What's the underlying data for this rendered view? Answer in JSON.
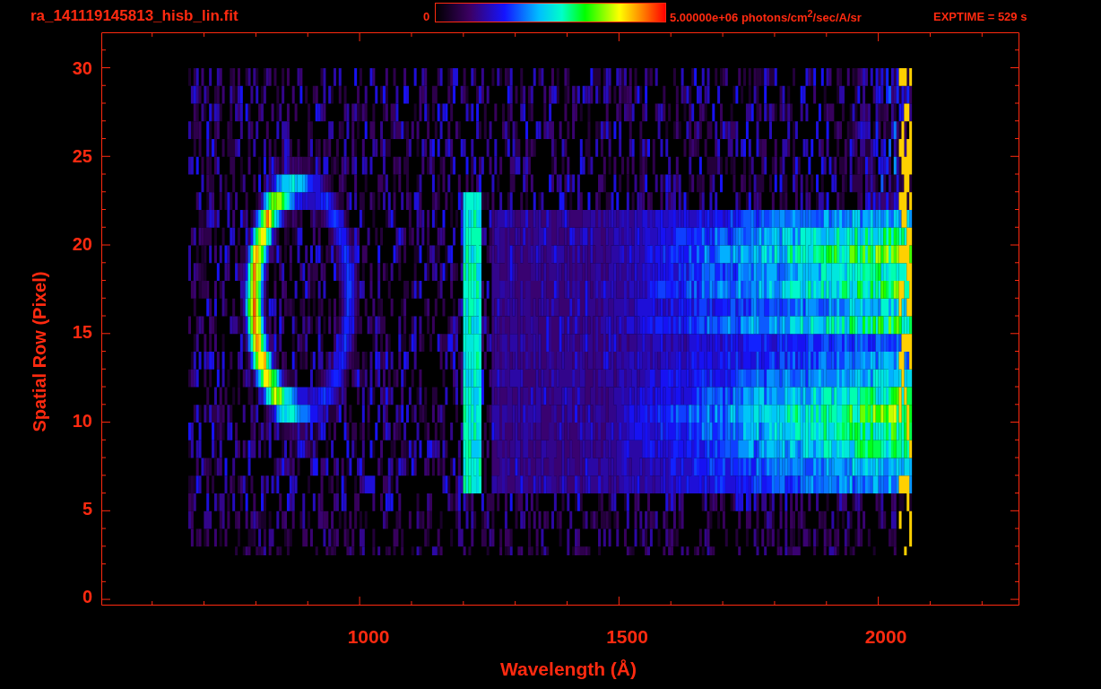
{
  "title": "ra_141119145813_hisb_lin.fit",
  "colorbar": {
    "min_label": "0",
    "max_label": "5.00000e+06 photons/cm$^{2}$/sec/A/sr"
  },
  "exposure": "EXPTIME = 529 s",
  "plot": {
    "ylabel": "Spatial Row (Pixel)",
    "xlabel": "Wavelength (Å)",
    "yticks": [
      "30",
      "25",
      "20",
      "15",
      "10",
      "5",
      "0"
    ],
    "xticks": [
      "1000",
      "1500",
      "2000"
    ]
  }
}
